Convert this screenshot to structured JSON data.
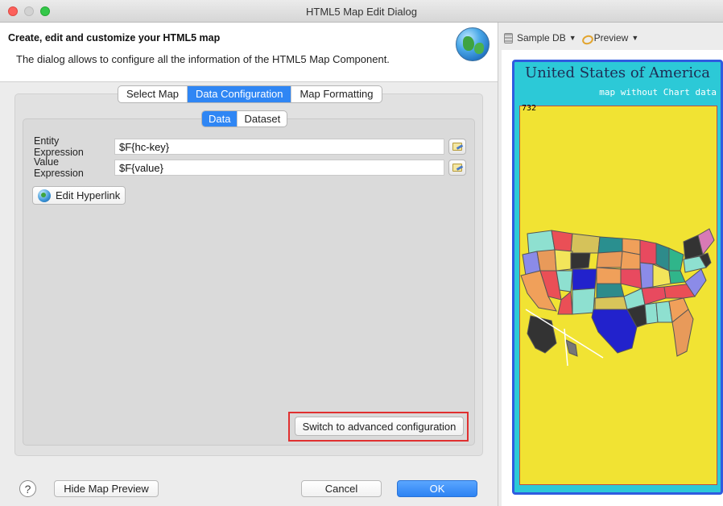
{
  "window": {
    "title": "HTML5 Map Edit Dialog"
  },
  "header": {
    "title": "Create, edit and customize your HTML5 map",
    "description": "The dialog allows to configure all the information of the HTML5 Map Component."
  },
  "tabs": [
    {
      "label": "Select Map",
      "active": false
    },
    {
      "label": "Data Configuration",
      "active": true
    },
    {
      "label": "Map Formatting",
      "active": false
    }
  ],
  "subtabs": [
    {
      "label": "Data",
      "active": true
    },
    {
      "label": "Dataset",
      "active": false
    }
  ],
  "fields": {
    "entity": {
      "label": "Entity Expression",
      "value": "$F{hc-key}"
    },
    "value": {
      "label": "Value Expression",
      "value": "$F{value}"
    }
  },
  "buttons": {
    "edit_hyperlink": "Edit Hyperlink",
    "switch_advanced": "Switch to advanced configuration",
    "help": "?",
    "hide_preview": "Hide Map Preview",
    "cancel": "Cancel",
    "ok": "OK"
  },
  "preview_toolbar": {
    "datasource": "Sample DB",
    "preview": "Preview",
    "datasource_icon": "database-icon",
    "preview_icon": "preview-icon"
  },
  "map_preview": {
    "title": "United States of America",
    "subtitle": "map without Chart data",
    "code": "732",
    "credit": "",
    "colors": {
      "frame": "#2cc9d7",
      "border": "#2f5be0",
      "background": "#f1e333"
    }
  },
  "colors": {
    "accent": "#2f86f4",
    "highlight_border": "#e03030"
  }
}
